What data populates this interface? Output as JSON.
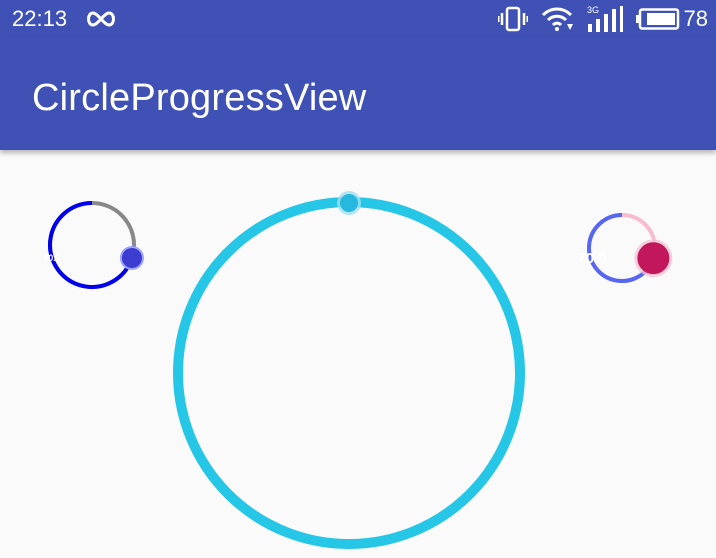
{
  "status_bar": {
    "time": "22:13",
    "battery_level": "78",
    "signal_type": "3G",
    "icons": [
      "infinity-icon",
      "vibrate-icon",
      "wifi-icon",
      "cellular-signal-icon",
      "battery-icon"
    ]
  },
  "app_bar": {
    "title": "CircleProgressView",
    "color": "#3f51b5"
  },
  "progress_views": {
    "left": {
      "value_label": "70.0",
      "progress": 0.7,
      "progress_color": "#0000ee",
      "track_color": "#888888",
      "thumb_color": "#3d3dcf"
    },
    "center": {
      "progress": 1.0,
      "progress_color": "#26c6e6",
      "thumb_color": "#26b8df"
    },
    "right": {
      "value_label": "70.0",
      "progress": 0.7,
      "progress_color": "#5566f2",
      "track_color": "#f7bcd0",
      "thumb_color": "#c2185b"
    }
  }
}
